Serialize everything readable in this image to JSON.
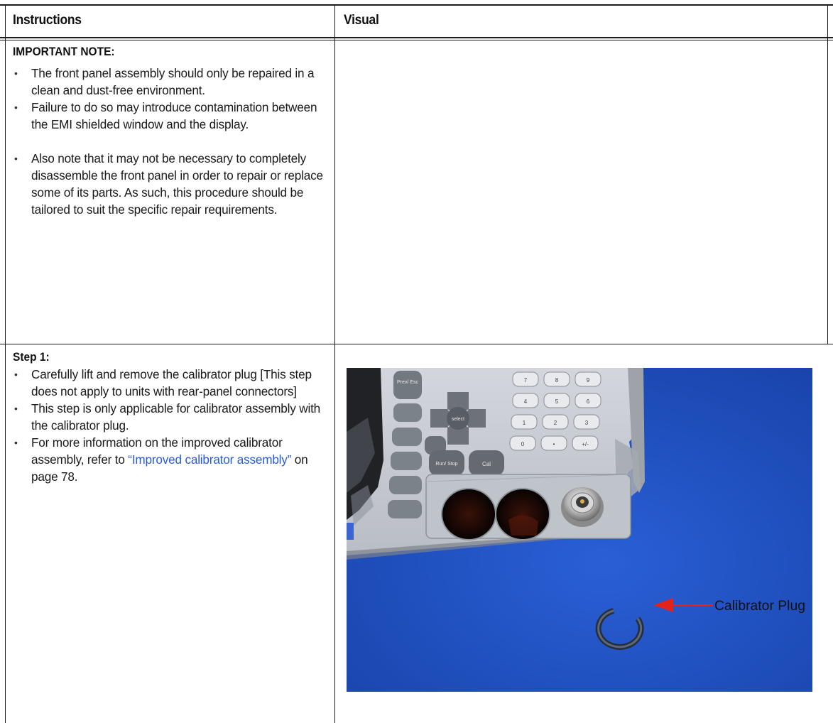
{
  "header": {
    "col1_label": "Instructions",
    "col2_label": "Visual"
  },
  "row1": {
    "title": "IMPORTANT NOTE:",
    "bullets": [
      "The front panel assembly should only be repaired in a clean and dust-free environment.",
      "Failure to do so may introduce contamination between the EMI shielded window and the display.",
      "Also note that it may not be necessary to completely disassemble the front panel in order to repair or replace some of its parts. As such, this procedure should be tailored to suit the specific repair requirements."
    ]
  },
  "row2": {
    "title": "Step 1:",
    "bullet1": "Carefully lift and remove the calibrator plug [This step does not apply to units with rear-panel connectors]",
    "bullet2": "This step is only applicable for calibrator assembly with the calibrator plug.",
    "bullet3_prefix": "For more information on the improved calibrator assembly, refer to ",
    "bullet3_link": "“Improved calibrator assembly”",
    "bullet3_suffix": " on page 78."
  },
  "photo": {
    "callout_label": "Calibrator Plug",
    "keys": {
      "prev_esc": "Prev/ Esc",
      "select": "select",
      "run_stop": "Run/ Stop",
      "cal": "Cal",
      "k7": "7",
      "k8": "8",
      "k9": "9",
      "k4": "4",
      "k5": "5",
      "k6": "6",
      "k1": "1",
      "k2": "2",
      "k3": "3",
      "k0": "0",
      "kdot": "•",
      "kpm": "+/-"
    },
    "colors": {
      "background_blue": "#1f4fc0",
      "panel_gray": "#c9cdd3",
      "callout_red": "#e2231a"
    }
  }
}
